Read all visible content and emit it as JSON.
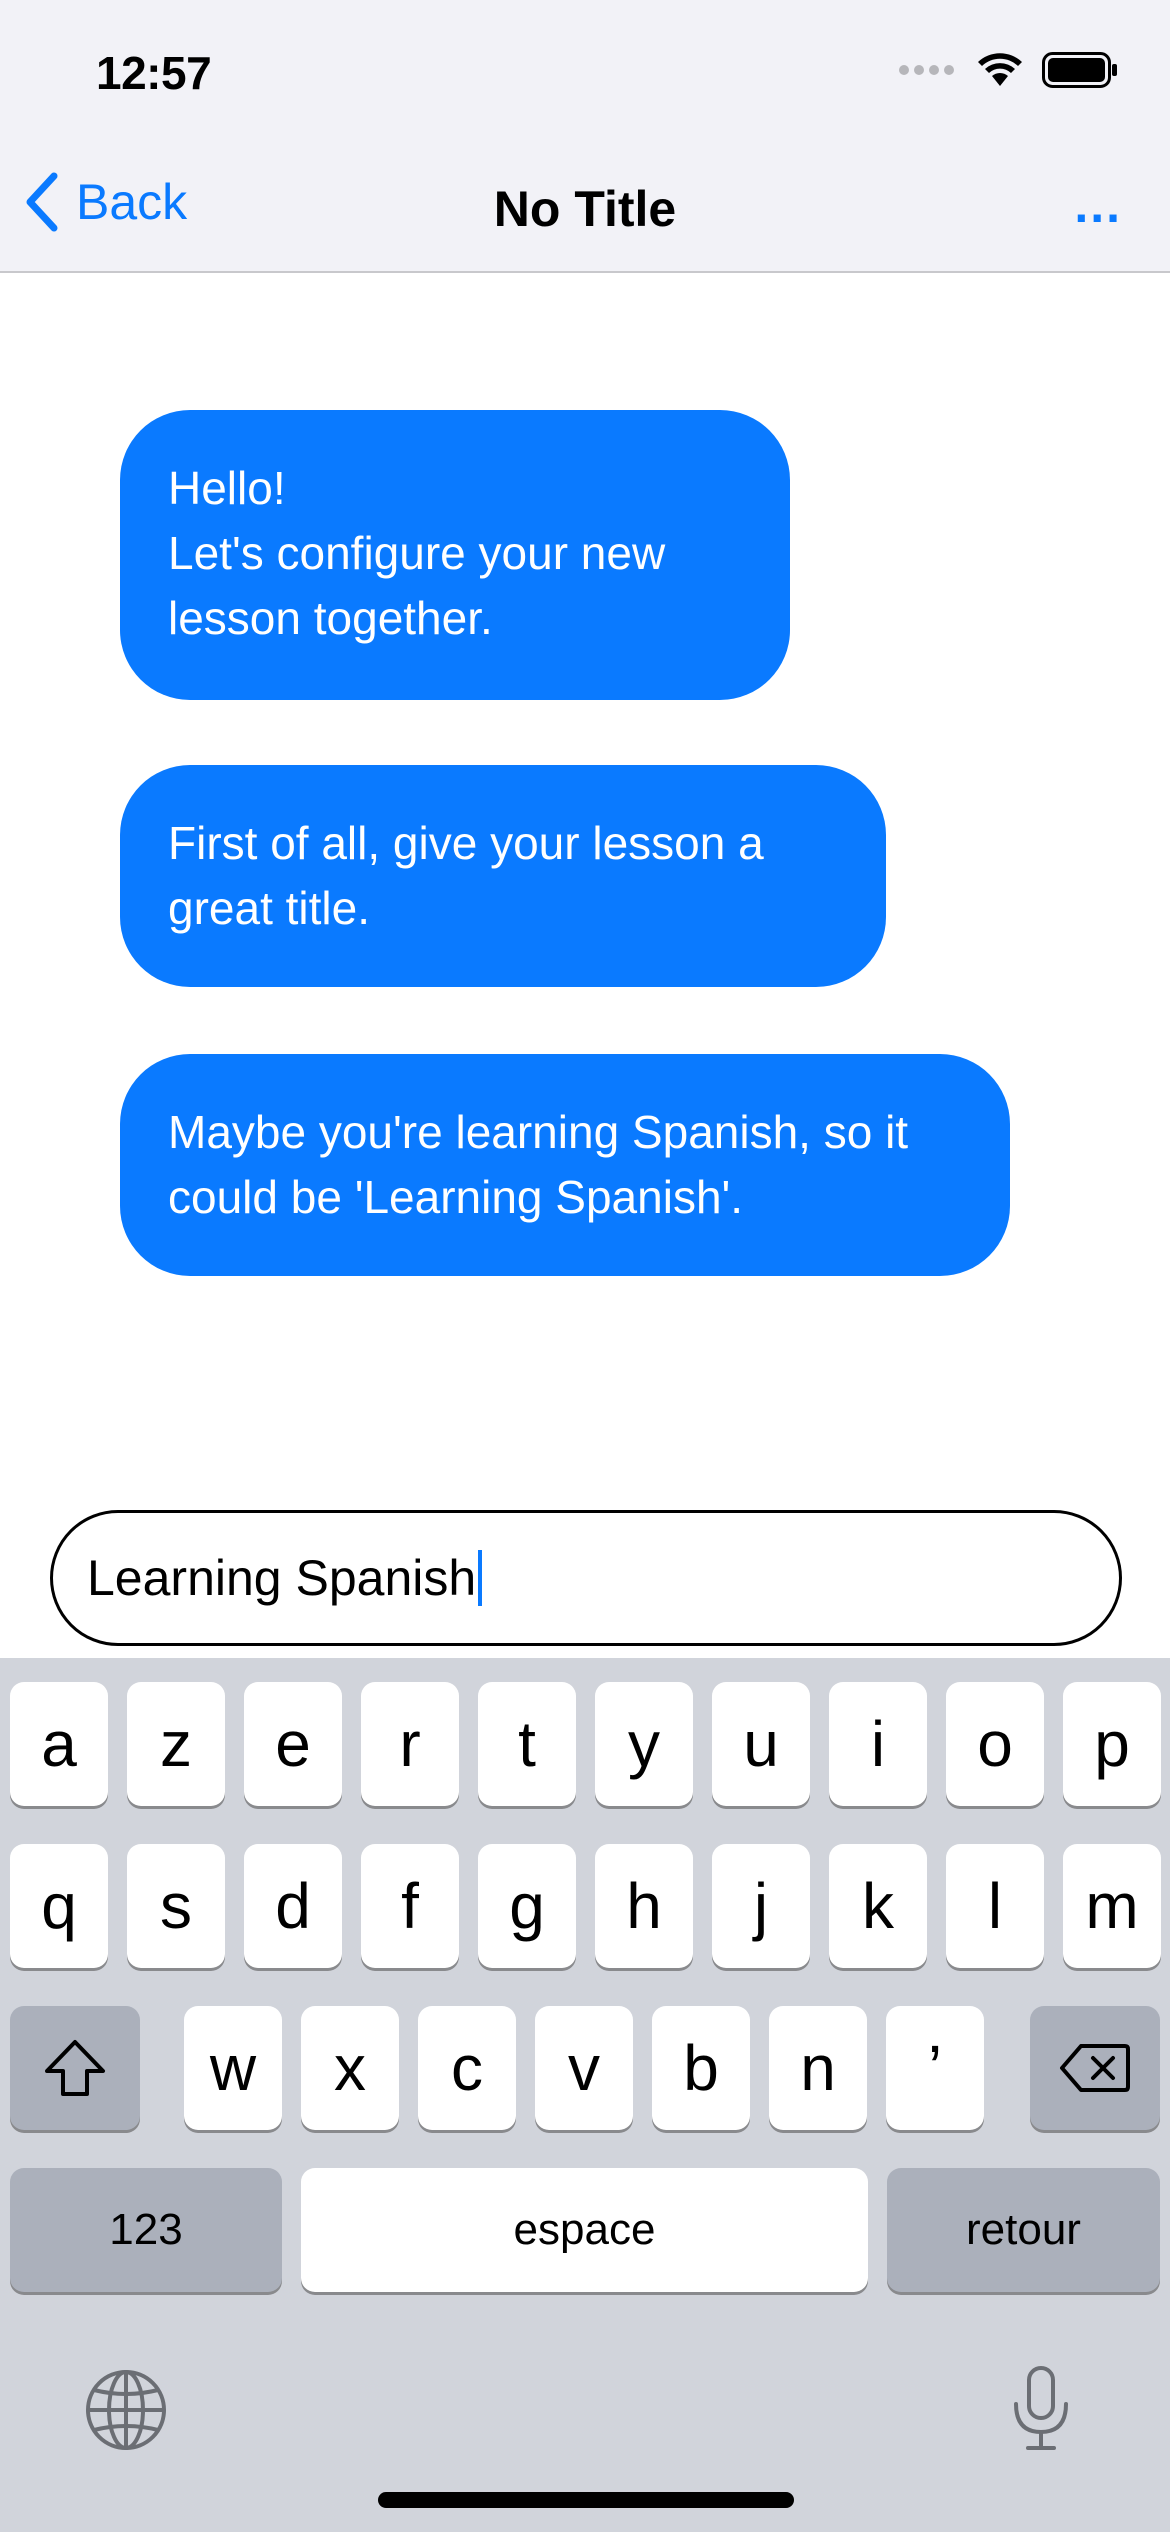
{
  "status_bar": {
    "time": "12:57"
  },
  "nav": {
    "back_label": "Back",
    "title": "No Title",
    "more_label": "..."
  },
  "messages": [
    "Hello!\nLet's configure your new lesson together.",
    "First of all, give your lesson a great title.",
    "Maybe you're learning Spanish, so it could be 'Learning Spanish'."
  ],
  "input": {
    "value": "Learning Spanish"
  },
  "keyboard": {
    "row1": [
      "a",
      "z",
      "e",
      "r",
      "t",
      "y",
      "u",
      "i",
      "o",
      "p"
    ],
    "row2": [
      "q",
      "s",
      "d",
      "f",
      "g",
      "h",
      "j",
      "k",
      "l",
      "m"
    ],
    "row3": [
      "w",
      "x",
      "c",
      "v",
      "b",
      "n",
      "’"
    ],
    "numbers_label": "123",
    "space_label": "espace",
    "return_label": "retour"
  },
  "colors": {
    "accent": "#0a7aff",
    "keyboard_bg": "#d1d4db",
    "nav_bg": "#f2f2f7"
  }
}
